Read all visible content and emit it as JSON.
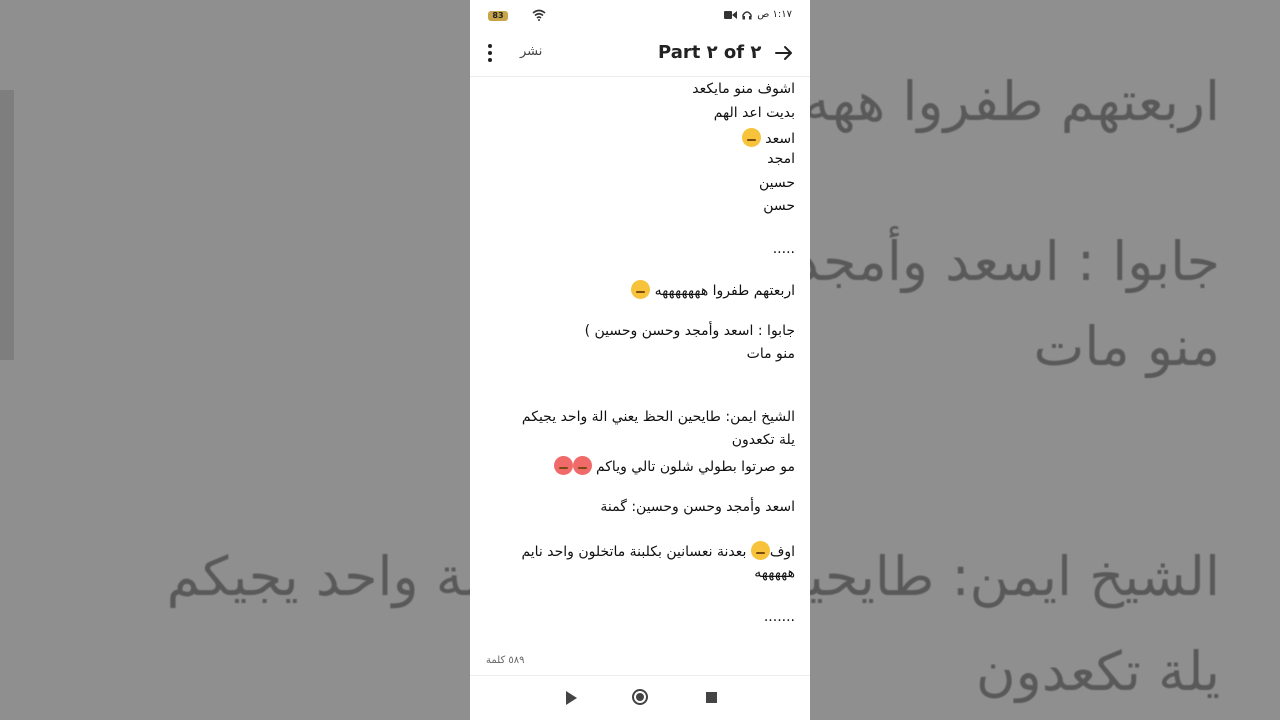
{
  "background": {
    "lines": [
      "اربعتهم طفروا ههه",
      "جابوا : اسعد وأمجد وحسين )",
      "منو مات",
      "الشيخ ايمن: طايحين الحظ يعني الة واحد يجيكم",
      "يلة تكعدون"
    ]
  },
  "status_bar": {
    "time": "١:١٧ ص",
    "battery": "83",
    "icons": [
      "battery-icon",
      "wifi-icon",
      "headphones-icon",
      "video-icon"
    ]
  },
  "app_bar": {
    "title": "Part ٢ of ٢",
    "publish_label": "نشر",
    "icons": [
      "more-vert-icon",
      "arrow-forward-icon"
    ]
  },
  "story": {
    "lines": [
      "اشوف منو  مايكعد",
      "بديت اعد الهم",
      "اسعد",
      "امجد",
      "حسين",
      "حسن",
      ".....",
      "اربعتهم طفروا هههههههه",
      "جابوا : اسعد وأمجد وحسن وحسين )",
      "منو مات",
      "الشيخ ايمن: طايحين الحظ  يعني الة واحد يجيكم",
      "يلة تكعدون",
      "مو صرتوا بطولي شلون تالي وياكم",
      "اسعد وأمجد وحسن وحسين: گمنة",
      "اوف",
      "بعدنة نعسانين بكلبنة  ماتخلون واحد نايم",
      "هههههه",
      "......."
    ],
    "emojis": [
      "smirk-emoji",
      "laughing-tears-emoji",
      "angry-emoji",
      "woozy-emoji"
    ]
  },
  "footer": {
    "word_count": "٥٨٩ كلمة"
  },
  "nav_bar": {
    "icons": [
      "back-icon",
      "home-icon",
      "recent-apps-icon"
    ]
  }
}
